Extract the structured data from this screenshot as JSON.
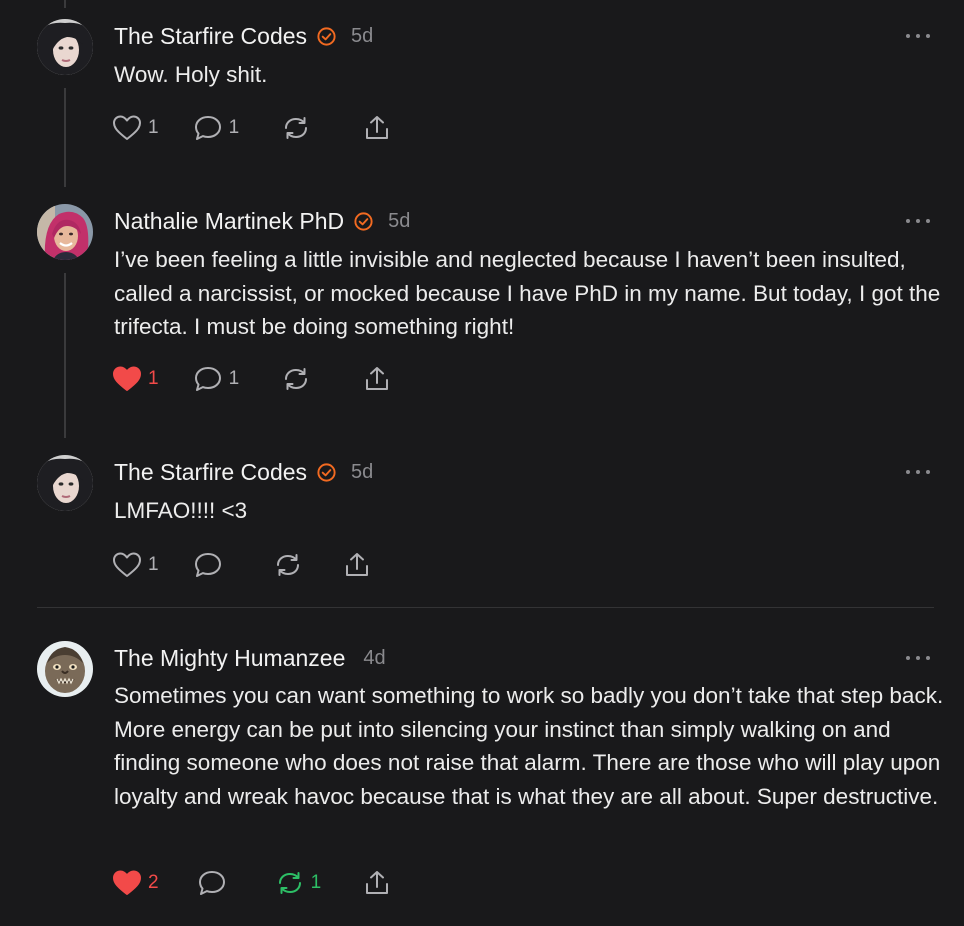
{
  "colors": {
    "background": "#19191b",
    "accent": "#f26a21",
    "liked": "#f24a49",
    "restacked": "#2dbf66",
    "muted": "#8a8a8e"
  },
  "comments": [
    {
      "author": "The Starfire Codes",
      "verified": true,
      "time": "5d",
      "text": "Wow. Holy shit.",
      "likes": "1",
      "liked": false,
      "replies": "1",
      "restacks": "",
      "restacked": false
    },
    {
      "author": "Nathalie Martinek PhD",
      "verified": true,
      "time": "5d",
      "text": "I’ve been feeling a little invisible and neglected because I haven’t been insulted, called a narcissist, or mocked because I have PhD in my name. But today, I got the trifecta. I must be doing something right!",
      "likes": "1",
      "liked": true,
      "replies": "1",
      "restacks": "",
      "restacked": false
    },
    {
      "author": "The Starfire Codes",
      "verified": true,
      "time": "5d",
      "text": "LMFAO!!!! <3",
      "likes": "1",
      "liked": false,
      "replies": "",
      "restacks": "",
      "restacked": false
    },
    {
      "author": "The Mighty Humanzee",
      "verified": false,
      "time": "4d",
      "text": "Sometimes you can want something to work so badly you don’t take that step back. More energy can be put into silencing your instinct than simply walking on and finding someone who does not raise that alarm. There are those who will play upon loyalty and wreak havoc because that is what they are all about. Super destructive.",
      "likes": "2",
      "liked": true,
      "replies": "",
      "restacks": "1",
      "restacked": true
    }
  ]
}
